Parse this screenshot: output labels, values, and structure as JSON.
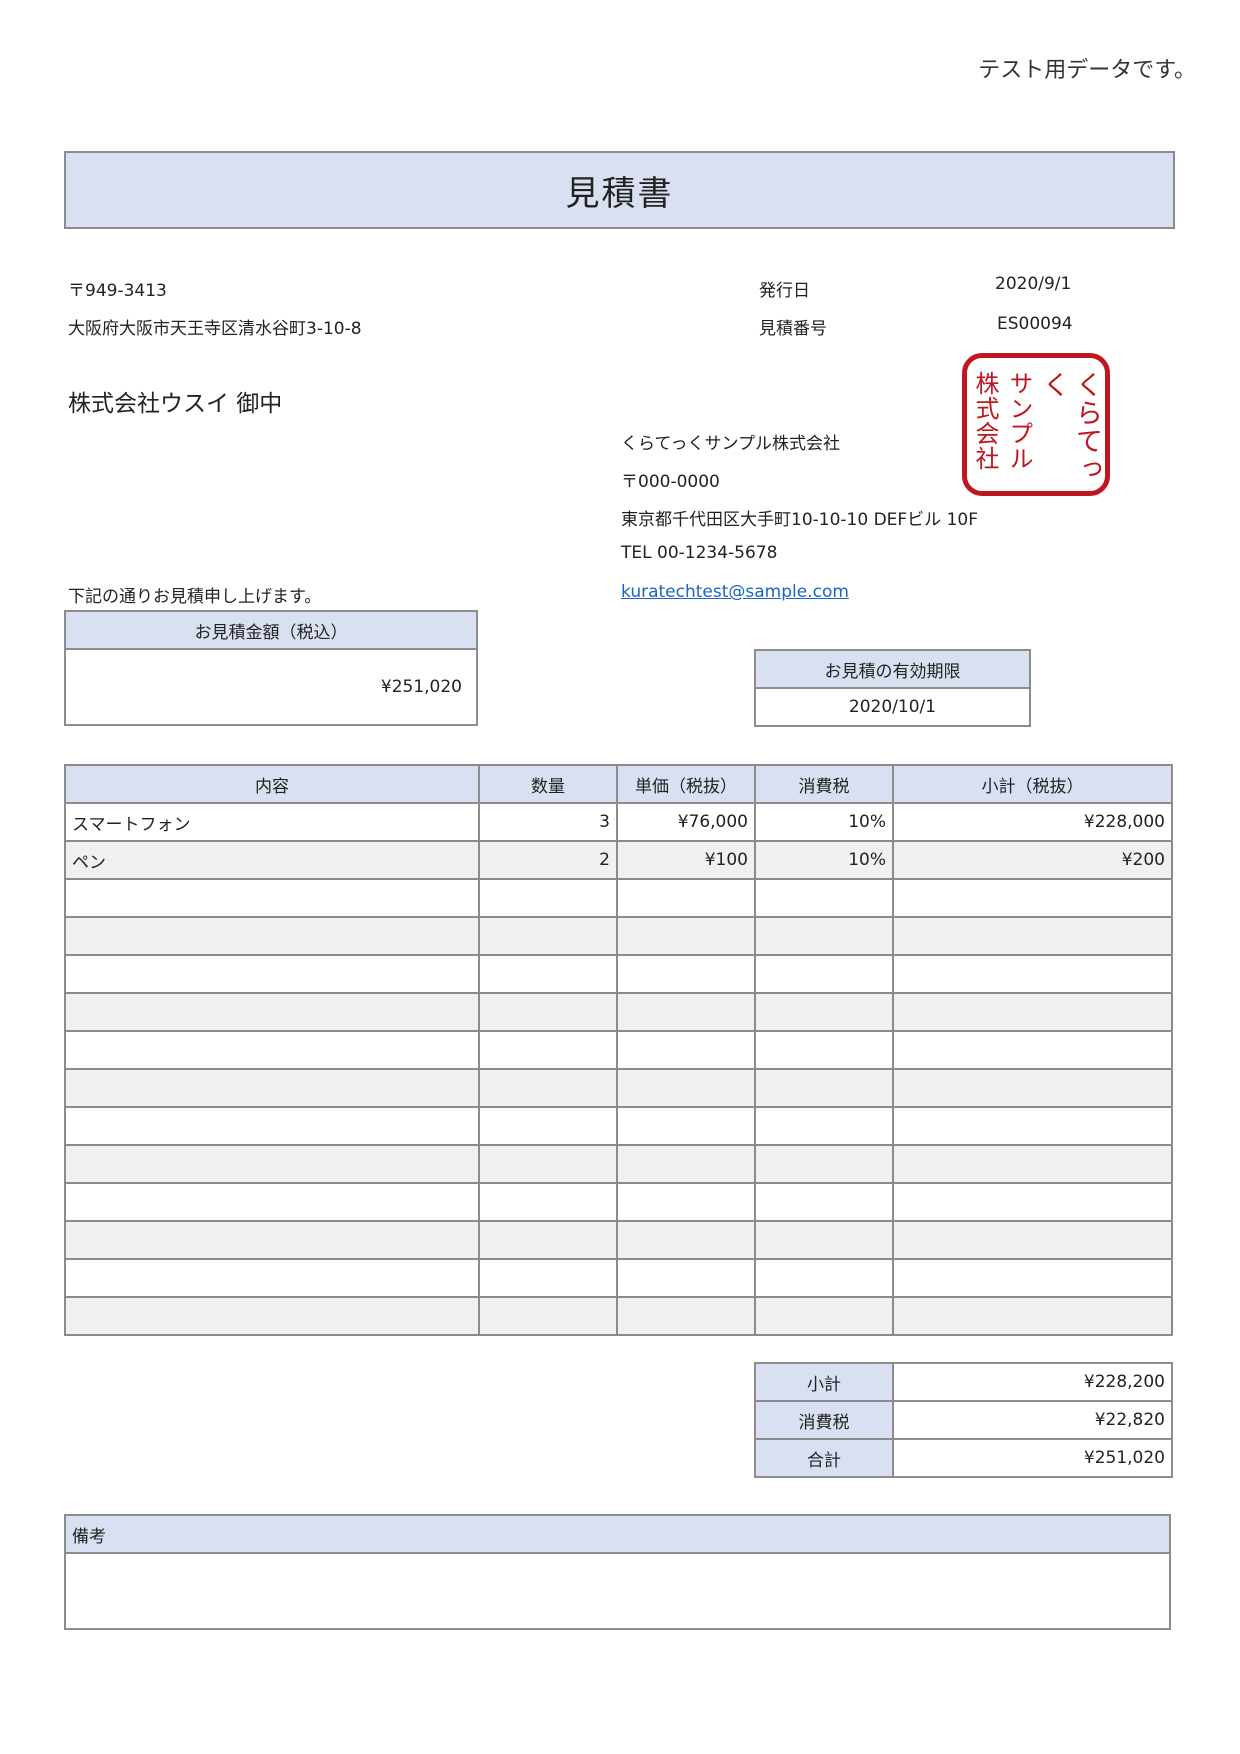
{
  "note": "テスト用データです。",
  "title": "見積書",
  "client": {
    "postal": "〒949-3413",
    "address": "大阪府大阪市天王寺区清水谷町3-10-8",
    "name": "株式会社ウスイ 御中"
  },
  "meta": {
    "issue_date_label": "発行日",
    "issue_date": "2020/9/1",
    "quote_no_label": "見積番号",
    "quote_no": "ES00094"
  },
  "issuer": {
    "company": "くらてっくサンプル株式会社",
    "postal": "〒000-0000",
    "address": "東京都千代田区大手町10-10-10 DEFビル 10F",
    "tel": "TEL 00-1234-5678",
    "email": "kuratechtest@sample.com"
  },
  "stamp": {
    "line1": "くらてっく",
    "line2": "サンプル",
    "line3": "株式会社",
    "color": "#c0161f"
  },
  "intro": "下記の通りお見積申し上げます。",
  "total_box": {
    "label": "お見積金額（税込）",
    "value": "¥251,020"
  },
  "validity": {
    "label": "お見積の有効期限",
    "value": "2020/10/1"
  },
  "items": {
    "headers": [
      "内容",
      "数量",
      "単価（税抜）",
      "消費税",
      "小計（税抜）"
    ],
    "rows": [
      {
        "desc": "スマートフォン",
        "qty": "3",
        "price": "¥76,000",
        "tax": "10%",
        "subtotal": "¥228,000"
      },
      {
        "desc": "ペン",
        "qty": "2",
        "price": "¥100",
        "tax": "10%",
        "subtotal": "¥200"
      },
      {
        "desc": "",
        "qty": "",
        "price": "",
        "tax": "",
        "subtotal": ""
      },
      {
        "desc": "",
        "qty": "",
        "price": "",
        "tax": "",
        "subtotal": ""
      },
      {
        "desc": "",
        "qty": "",
        "price": "",
        "tax": "",
        "subtotal": ""
      },
      {
        "desc": "",
        "qty": "",
        "price": "",
        "tax": "",
        "subtotal": ""
      },
      {
        "desc": "",
        "qty": "",
        "price": "",
        "tax": "",
        "subtotal": ""
      },
      {
        "desc": "",
        "qty": "",
        "price": "",
        "tax": "",
        "subtotal": ""
      },
      {
        "desc": "",
        "qty": "",
        "price": "",
        "tax": "",
        "subtotal": ""
      },
      {
        "desc": "",
        "qty": "",
        "price": "",
        "tax": "",
        "subtotal": ""
      },
      {
        "desc": "",
        "qty": "",
        "price": "",
        "tax": "",
        "subtotal": ""
      },
      {
        "desc": "",
        "qty": "",
        "price": "",
        "tax": "",
        "subtotal": ""
      },
      {
        "desc": "",
        "qty": "",
        "price": "",
        "tax": "",
        "subtotal": ""
      },
      {
        "desc": "",
        "qty": "",
        "price": "",
        "tax": "",
        "subtotal": ""
      }
    ]
  },
  "summary": [
    {
      "label": "小計",
      "value": "¥228,200"
    },
    {
      "label": "消費税",
      "value": "¥22,820"
    },
    {
      "label": "合計",
      "value": "¥251,020"
    }
  ],
  "remarks": {
    "label": "備考",
    "value": ""
  },
  "colors": {
    "header_bg": "#d9e0f1",
    "border": "#8c8c8c",
    "alt_row": "#f0f0f0",
    "link": "#1a64c4"
  }
}
